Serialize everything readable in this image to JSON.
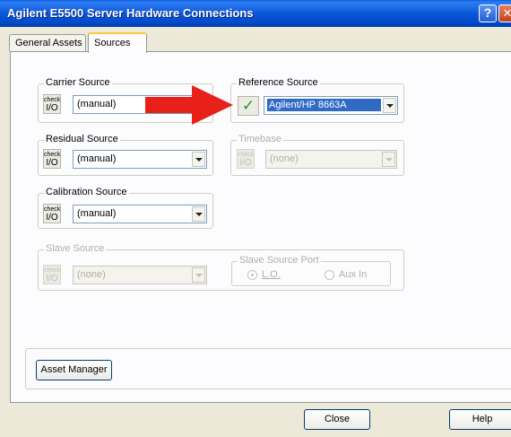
{
  "window": {
    "title": "Agilent E5500 Server Hardware Connections",
    "help_glyph": "?",
    "close_glyph": "✕"
  },
  "tabs": [
    {
      "label": "General Assets",
      "active": false
    },
    {
      "label": "Sources",
      "active": true
    }
  ],
  "check_button": {
    "top": "check",
    "bottom": "I/O"
  },
  "carrier_source": {
    "label": "Carrier Source",
    "value": "(manual)"
  },
  "reference_source": {
    "label": "Reference Source",
    "value": "Agilent/HP 8663A",
    "status_icon": "green-checkmark"
  },
  "residual_source": {
    "label": "Residual Source",
    "value": "(manual)"
  },
  "timebase": {
    "label": "Timebase",
    "value": "(none)",
    "enabled": false
  },
  "calibration_source": {
    "label": "Calibration Source",
    "value": "(manual)"
  },
  "slave_source": {
    "label": "Slave Source",
    "value": "(none)",
    "enabled": false,
    "port": {
      "label": "Slave Source Port",
      "options": [
        "L.O.",
        "Aux In"
      ],
      "selected": "L.O."
    }
  },
  "buttons": {
    "asset_manager": "Asset Manager",
    "close": "Close",
    "help": "Help"
  },
  "annotation": {
    "arrow_color": "#e8201a"
  },
  "colors": {
    "title_bar": "#0b57d8",
    "tab_highlight": "#ffc83c",
    "selection": "#316ac5",
    "check_green": "#1b9a2c"
  }
}
